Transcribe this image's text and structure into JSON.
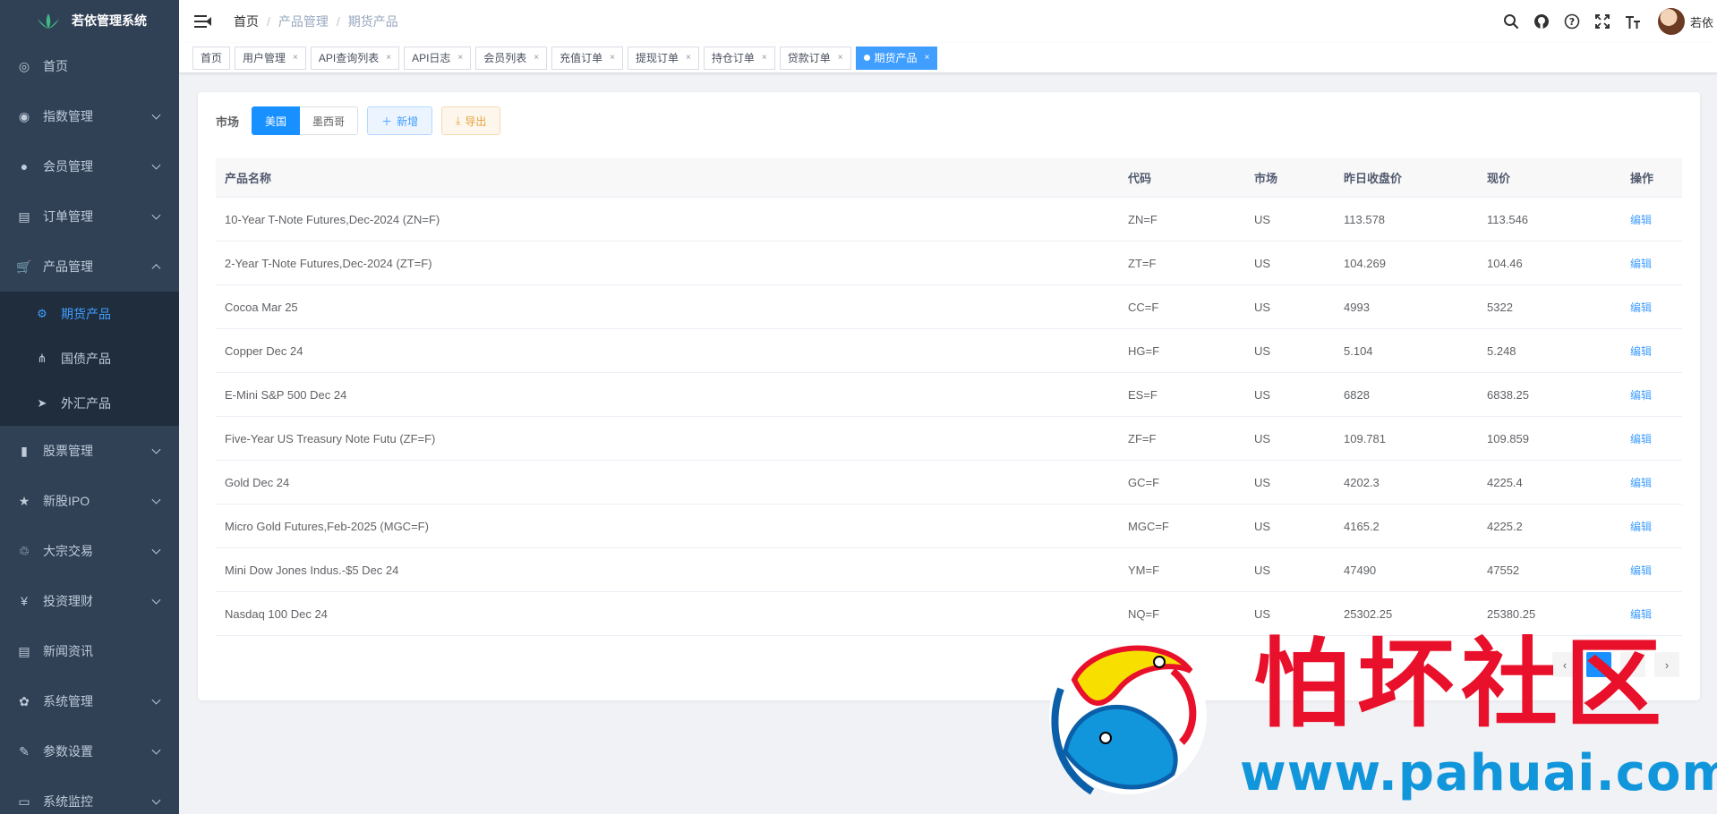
{
  "app": {
    "title": "若依管理系统"
  },
  "sidebar": {
    "items": [
      {
        "label": "首页",
        "icon": "dashboard-icon",
        "glyph": "◎",
        "expandable": false
      },
      {
        "label": "指数管理",
        "icon": "index-icon",
        "glyph": "◉",
        "expandable": true
      },
      {
        "label": "会员管理",
        "icon": "user-icon",
        "glyph": "●",
        "expandable": true
      },
      {
        "label": "订单管理",
        "icon": "order-icon",
        "glyph": "▤",
        "expandable": true
      },
      {
        "label": "产品管理",
        "icon": "cart-icon",
        "glyph": "🛒",
        "expandable": true,
        "expanded": true,
        "children": [
          {
            "label": "期货产品",
            "icon": "futures-icon",
            "glyph": "⚙",
            "active": true
          },
          {
            "label": "国债产品",
            "icon": "tree-icon",
            "glyph": "⋔"
          },
          {
            "label": "外汇产品",
            "icon": "send-icon",
            "glyph": "➤"
          }
        ]
      },
      {
        "label": "股票管理",
        "icon": "chart-icon",
        "glyph": "▮",
        "expandable": true
      },
      {
        "label": "新股IPO",
        "icon": "star-icon",
        "glyph": "★",
        "expandable": true
      },
      {
        "label": "大宗交易",
        "icon": "trade-icon",
        "glyph": "♲",
        "expandable": true
      },
      {
        "label": "投资理财",
        "icon": "yen-icon",
        "glyph": "¥",
        "expandable": true
      },
      {
        "label": "新闻资讯",
        "icon": "news-icon",
        "glyph": "▤",
        "expandable": false
      },
      {
        "label": "系统管理",
        "icon": "gear-icon",
        "glyph": "✿",
        "expandable": true
      },
      {
        "label": "参数设置",
        "icon": "edit-icon",
        "glyph": "✎",
        "expandable": true
      },
      {
        "label": "系统监控",
        "icon": "monitor-icon",
        "glyph": "▭",
        "expandable": true
      }
    ]
  },
  "navbar": {
    "breadcrumb": [
      "首页",
      "产品管理",
      "期货产品"
    ],
    "user": "若依"
  },
  "tags": [
    {
      "label": "首页",
      "closable": false
    },
    {
      "label": "用户管理",
      "closable": true
    },
    {
      "label": "API查询列表",
      "closable": true
    },
    {
      "label": "API日志",
      "closable": true
    },
    {
      "label": "会员列表",
      "closable": true
    },
    {
      "label": "充值订单",
      "closable": true
    },
    {
      "label": "提现订单",
      "closable": true
    },
    {
      "label": "持仓订单",
      "closable": true
    },
    {
      "label": "贷款订单",
      "closable": true
    },
    {
      "label": "期货产品",
      "closable": true,
      "active": true
    }
  ],
  "toolbar": {
    "market_label": "市场",
    "markets": [
      "美国",
      "墨西哥"
    ],
    "add_label": "新增",
    "export_label": "导出"
  },
  "table": {
    "columns": [
      "产品名称",
      "代码",
      "市场",
      "昨日收盘价",
      "现价",
      "操作"
    ],
    "action_label": "编辑",
    "rows": [
      [
        "10-Year T-Note Futures,Dec-2024 (ZN=F)",
        "ZN=F",
        "US",
        "113.578",
        "113.546"
      ],
      [
        "2-Year T-Note Futures,Dec-2024 (ZT=F)",
        "ZT=F",
        "US",
        "104.269",
        "104.46"
      ],
      [
        "Cocoa Mar 25",
        "CC=F",
        "US",
        "4993",
        "5322"
      ],
      [
        "Copper Dec 24",
        "HG=F",
        "US",
        "5.104",
        "5.248"
      ],
      [
        "E-Mini S&P 500 Dec 24",
        "ES=F",
        "US",
        "6828",
        "6838.25"
      ],
      [
        "Five-Year US Treasury Note Futu (ZF=F)",
        "ZF=F",
        "US",
        "109.781",
        "109.859"
      ],
      [
        "Gold Dec 24",
        "GC=F",
        "US",
        "4202.3",
        "4225.4"
      ],
      [
        "Micro Gold Futures,Feb-2025 (MGC=F)",
        "MGC=F",
        "US",
        "4165.2",
        "4225.2"
      ],
      [
        "Mini Dow Jones Indus.-$5 Dec 24",
        "YM=F",
        "US",
        "47490",
        "47552"
      ],
      [
        "Nasdaq 100 Dec 24",
        "NQ=F",
        "US",
        "25302.25",
        "25380.25"
      ]
    ]
  },
  "pagination": {
    "pages": [
      "1",
      "2"
    ],
    "current": "1"
  },
  "watermark": {
    "text_cn": "怕坏社区",
    "url": "www.pahuai.com"
  },
  "colors": {
    "sidebar_bg": "#304156",
    "primary": "#1890ff",
    "watermark_red": "#e8102a",
    "watermark_blue": "#1296db"
  }
}
